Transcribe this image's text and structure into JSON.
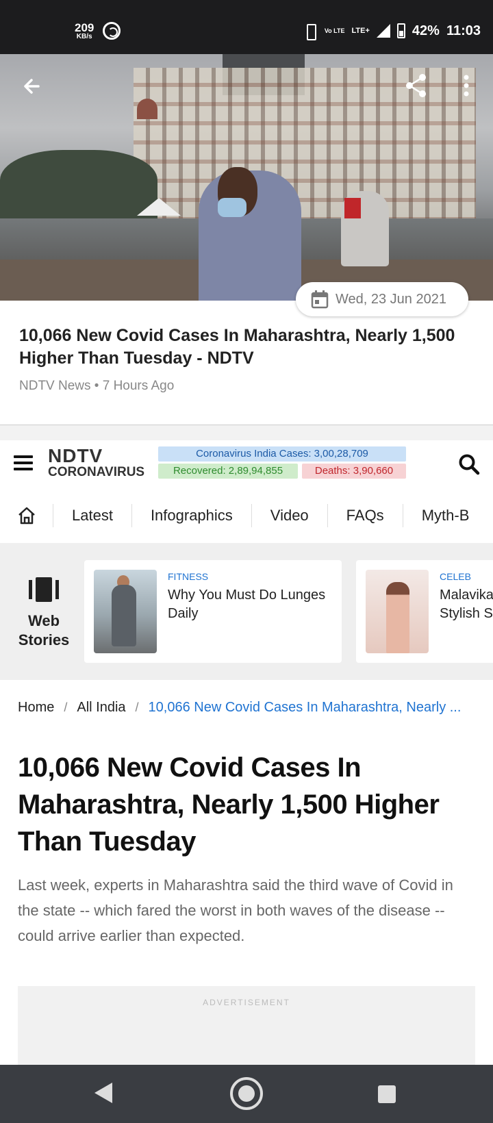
{
  "status_bar": {
    "speed_value": "209",
    "speed_unit": "KB/s",
    "volte": "Vo LTE",
    "lte": "LTE+",
    "battery": "42%",
    "time": "11:03"
  },
  "hero": {
    "date": "Wed, 23 Jun 2021"
  },
  "card": {
    "title": "10,066 New Covid Cases In Maharashtra, Nearly 1,500 Higher Than Tuesday - NDTV",
    "meta": "NDTV News • 7 Hours Ago"
  },
  "ndtv_header": {
    "logo_top": "NDTV",
    "logo_bottom": "CORONAVIRUS",
    "cases": "Coronavirus India Cases: 3,00,28,709",
    "recovered": "Recovered: 2,89,94,855",
    "deaths": "Deaths: 3,90,660"
  },
  "category_nav": {
    "items": [
      "Latest",
      "Infographics",
      "Video",
      "FAQs",
      "Myth-B"
    ]
  },
  "web_stories": {
    "label_line1": "Web",
    "label_line2": "Stories",
    "stories": [
      {
        "category": "FITNESS",
        "title": "Why You Must Do Lunges Daily"
      },
      {
        "category": "CELEB",
        "title": "Malavika Stylish S"
      }
    ]
  },
  "breadcrumb": {
    "home": "Home",
    "section": "All India",
    "current": "10,066 New Covid Cases In Maharashtra, Nearly ..."
  },
  "article": {
    "title": "10,066 New Covid Cases In Maharashtra, Nearly 1,500 Higher Than Tuesday",
    "summary": "Last week, experts in Maharashtra said the third wave of Covid in the state -- which fared the worst in both waves of the disease -- could arrive earlier than expected."
  },
  "ad": {
    "label": "ADVERTISEMENT"
  },
  "colors": {
    "accent_blue": "#1f73d1",
    "recovered_green": "#2e8b2e",
    "deaths_red": "#c0262c"
  }
}
